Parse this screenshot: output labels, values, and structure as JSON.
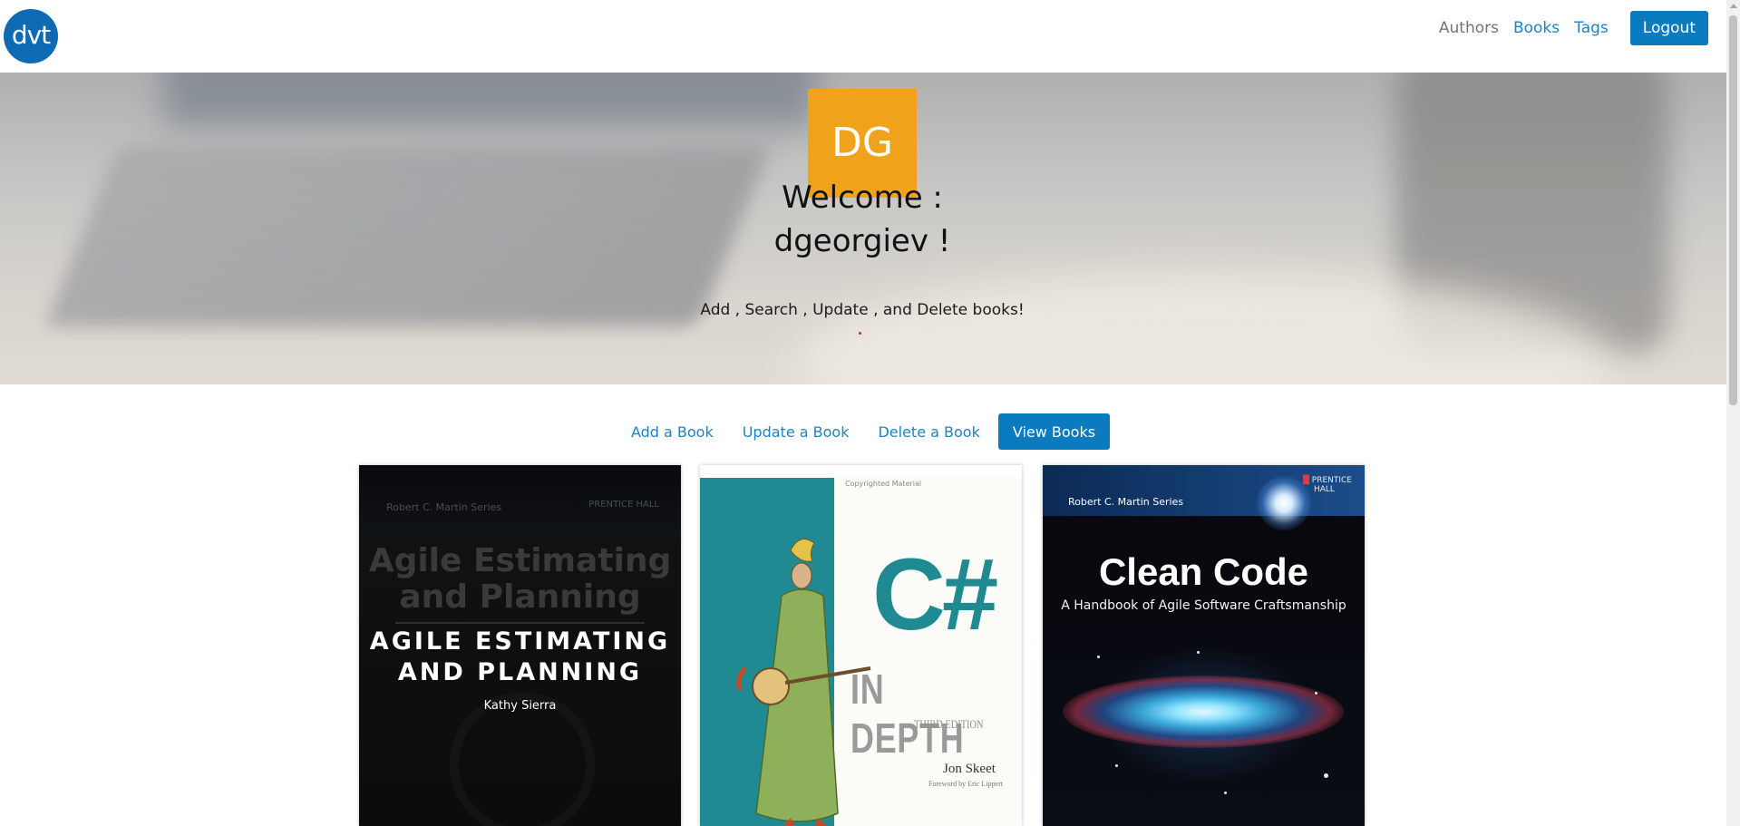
{
  "brand": {
    "logo_text": "dvt"
  },
  "nav": {
    "items": [
      {
        "label": "Authors",
        "state": "inactive"
      },
      {
        "label": "Books",
        "state": "active"
      },
      {
        "label": "Tags",
        "state": "active"
      }
    ],
    "logout_label": "Logout"
  },
  "hero": {
    "avatar_initials": "DG",
    "welcome_line1": "Welcome :",
    "welcome_line2": "dgeorgiev !",
    "subtitle": "Add , Search , Update , and Delete books!"
  },
  "actions": {
    "add_label": "Add a Book",
    "update_label": "Update a Book",
    "delete_label": "Delete a Book",
    "view_label": "View Books"
  },
  "books": [
    {
      "cover_series": "Robert C. Martin Series",
      "cover_publisher": "PRENTICE HALL",
      "cover_title": "Agile Estimating and Planning",
      "overlay_title": "AGILE ESTIMATING AND PLANNING",
      "overlay_author": "Kathy Sierra"
    },
    {
      "cover_copyright": "Copyrighted Material",
      "cover_title_main": "C#",
      "cover_title_sub": "IN DEPTH",
      "cover_edition": "THIRD EDITION",
      "cover_author": "Jon Skeet",
      "cover_foreword": "Foreword by Eric Lippert"
    },
    {
      "cover_series": "Robert C. Martin Series",
      "cover_publisher_line1": "PRENTICE",
      "cover_publisher_line2": "HALL",
      "cover_title": "Clean Code",
      "cover_subtitle": "A Handbook of Agile Software Craftsmanship"
    }
  ],
  "colors": {
    "primary": "#0b7bc0",
    "link": "#1d84c2",
    "avatar": "#f0a21a",
    "logo": "#0d6ab3"
  }
}
